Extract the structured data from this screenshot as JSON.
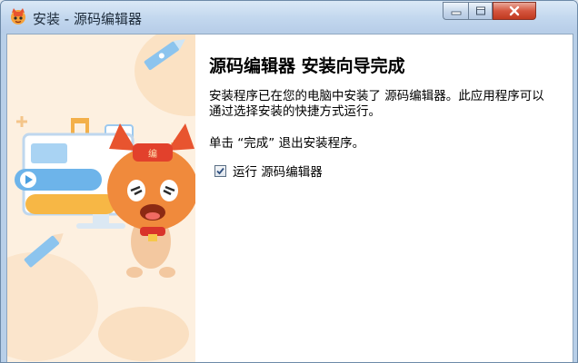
{
  "window": {
    "title": "安装 - 源码编辑器"
  },
  "content": {
    "heading": "源码编辑器  安装向导完成",
    "paragraph": "安装程序已在您的电脑中安装了 源码编辑器。此应用程序可以通过选择安装的快捷方式运行。",
    "instruction": "单击 “完成” 退出安装程序。",
    "run_checkbox": {
      "label": "运行 源码编辑器",
      "checked": true
    }
  },
  "colors": {
    "banner_bg": "#fdf0e0",
    "accent_blue": "#4a9fe0",
    "accent_orange": "#f7a93b",
    "mascot_red": "#e8542f"
  }
}
